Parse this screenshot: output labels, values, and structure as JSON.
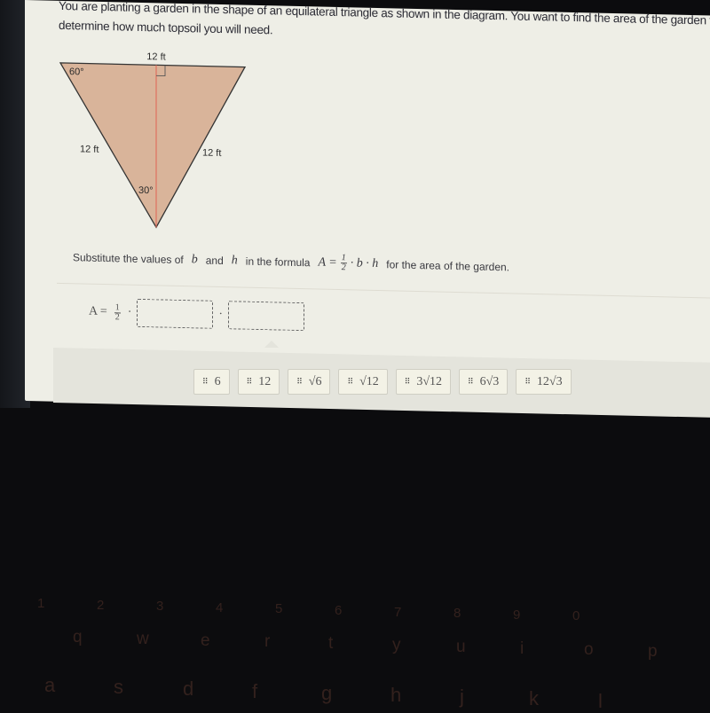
{
  "question": {
    "prompt": "You are planting a garden in the shape of an equilateral triangle as shown in the diagram. You want to find the area of the garden to determine how much topsoil you will need."
  },
  "diagram": {
    "top_side_label": "12 ft",
    "left_side_label": "12 ft",
    "right_side_label": "12 ft",
    "top_left_angle": "60°",
    "bottom_angle": "30°",
    "fill_color": "#d9b49a",
    "altitude_color": "#e07060"
  },
  "instruction": {
    "prefix": "Substitute the values of",
    "var_b": "b",
    "and": "and",
    "var_h": "h",
    "middle": "in the formula",
    "formula_lhs": "A =",
    "frac_num": "1",
    "frac_den": "2",
    "formula_rhs": "· b · h",
    "suffix": "for the area of the garden."
  },
  "answer": {
    "lhs": "A =",
    "frac_num": "1",
    "frac_den": "2",
    "dot": "·",
    "box1_value": "",
    "box2_value": ""
  },
  "tiles": [
    {
      "label": "6"
    },
    {
      "label": "12"
    },
    {
      "label": "√6"
    },
    {
      "label": "√12"
    },
    {
      "label": "3√12"
    },
    {
      "label": "6√3"
    },
    {
      "label": "12√3"
    }
  ],
  "keyboard": {
    "number_row": [
      "1",
      "2",
      "3",
      "4",
      "5",
      "6",
      "7",
      "8",
      "9",
      "0"
    ],
    "top_row": [
      "q",
      "w",
      "e",
      "r",
      "t",
      "y",
      "u",
      "i",
      "o",
      "p"
    ],
    "home_row": [
      "a",
      "s",
      "d",
      "f",
      "g",
      "h",
      "j",
      "k",
      "l"
    ]
  }
}
